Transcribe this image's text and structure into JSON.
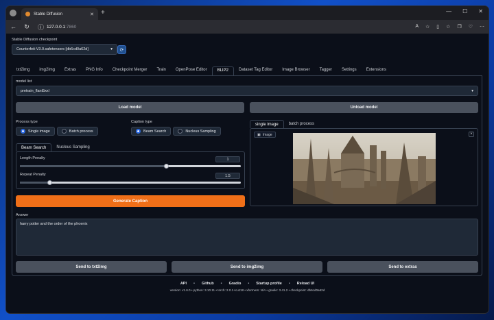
{
  "browser": {
    "tab_title": "Stable Diffusion",
    "url_host": "127.0.0.1",
    "url_port": ":7860"
  },
  "checkpoint": {
    "label": "Stable Diffusion checkpoint",
    "value": "Counterfeit-V3.0.safetensors [db6cd0a62d]"
  },
  "main_tabs": [
    "txt2img",
    "img2img",
    "Extras",
    "PNG Info",
    "Checkpoint Merger",
    "Train",
    "OpenPose Editor",
    "BLIP2",
    "Dataset Tag Editor",
    "Image Browser",
    "Tagger",
    "Settings",
    "Extensions"
  ],
  "active_main_tab": "BLIP2",
  "blip2": {
    "model_list_label": "model list",
    "model_list_value": "pretrain_flant5xxl",
    "load_model": "Load model",
    "unload_model": "Unload model",
    "process_type_label": "Process type",
    "process_single": "Single image",
    "process_batch": "Batch process",
    "caption_type_label": "Caption type",
    "caption_beam": "Beam Search",
    "caption_nucleus": "Nucleus Sampling",
    "sub_tab_beam": "Beam Search",
    "sub_tab_nucleus": "Nucleus Sampling",
    "length_penalty_label": "Length Penalty",
    "length_penalty_value": "1",
    "repeat_penalty_label": "Repeat Penalty",
    "repeat_penalty_value": "1.5",
    "generate_caption": "Generate Caption",
    "image_tab_single": "single image",
    "image_tab_batch": "batch process",
    "image_label": "Image",
    "answer_label": "Answer",
    "answer_value": "harry potter and the order of the phoenix",
    "send_txt2img": "Send to txt2img",
    "send_img2img": "Send to img2img",
    "send_extras": "Send to extras"
  },
  "footer": {
    "links": [
      "API",
      "Github",
      "Gradio",
      "Startup profile",
      "Reload UI"
    ],
    "info": "version: v1.6.0  •  python: 3.10.11  •  torch: 2.0.1+cu118  •  xformers: N/A  •  gradio: 3.41.2  •  checkpoint: db6cd0a62d"
  }
}
